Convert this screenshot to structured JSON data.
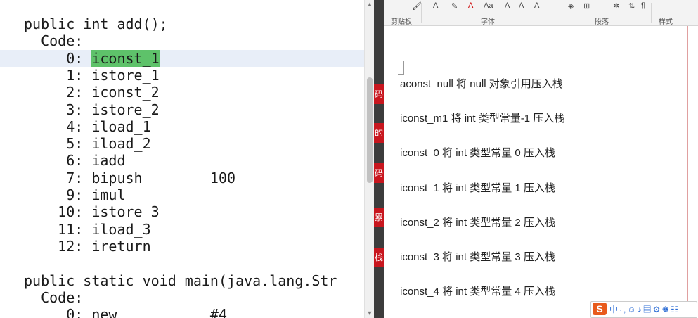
{
  "code": {
    "lines": [
      "public int add();",
      "  Code:",
      "     0: iconst_1",
      "     1: istore_1",
      "     2: iconst_2",
      "     3: istore_2",
      "     4: iload_1",
      "     5: iload_2",
      "     6: iadd",
      "     7: bipush        100",
      "     9: imul",
      "    10: istore_3",
      "    11: iload_3",
      "    12: ireturn",
      "",
      "public static void main(java.lang.Str",
      "  Code:",
      "     0: new           #4"
    ],
    "highlight_prefix": "     0: ",
    "highlight_word": "iconst_1"
  },
  "side_tags": [
    "码",
    "的",
    "码",
    "累",
    "栈"
  ],
  "ribbon": {
    "groups": [
      "剪贴板",
      "字体",
      "段落",
      "样式"
    ],
    "tools": [
      "A",
      "A",
      "Aa",
      "A",
      "A",
      "A"
    ]
  },
  "doc": {
    "lines": [
      "aconst_null  将 null 对象引用压入栈",
      "iconst_m1  将 int 类型常量-1 压入栈",
      "iconst_0  将 int 类型常量 0 压入栈",
      "iconst_1  将 int 类型常量 1 压入栈",
      "iconst_2  将 int 类型常量 2 压入栈",
      "iconst_3  将 int 类型常量 3 压入栈",
      "iconst_4  将 int 类型常量 4 压入栈"
    ]
  },
  "ime": {
    "logo": "S",
    "text": "中·,☺♪▤⚙♚☷"
  }
}
